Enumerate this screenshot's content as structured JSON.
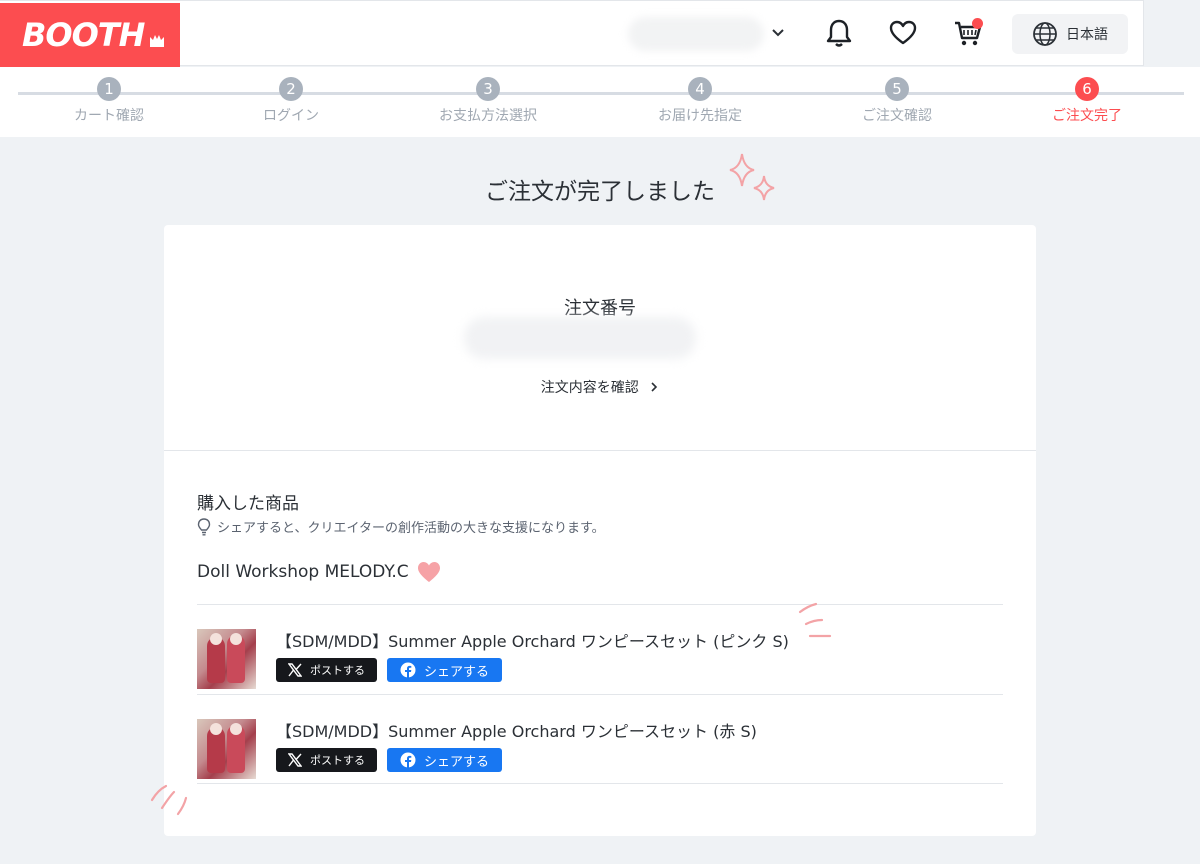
{
  "header": {
    "logo_text": "BOOTH",
    "language_label": "日本語"
  },
  "steps": [
    {
      "num": "1",
      "label": "カート確認"
    },
    {
      "num": "2",
      "label": "ログイン"
    },
    {
      "num": "3",
      "label": "お支払方法選択"
    },
    {
      "num": "4",
      "label": "お届け先指定"
    },
    {
      "num": "5",
      "label": "ご注文確認"
    },
    {
      "num": "6",
      "label": "ご注文完了"
    }
  ],
  "page_title": "ご注文が完了しました",
  "order": {
    "number_label": "注文番号",
    "details_link": "注文内容を確認"
  },
  "purchased": {
    "title": "購入した商品",
    "share_hint": "シェアすると、クリエイターの創作活動の大きな支援になります。",
    "shop_name": "Doll Workshop MELODY.C",
    "items": [
      {
        "name": "【SDM/MDD】Summer Apple Orchard ワンピースセット (ピンク S)",
        "x_label": "ポストする",
        "fb_label": "シェアする"
      },
      {
        "name": "【SDM/MDD】Summer Apple Orchard ワンピースセット (赤 S)",
        "x_label": "ポストする",
        "fb_label": "シェアする"
      }
    ]
  },
  "colors": {
    "brand": "#fc4d50",
    "facebook": "#1877f2",
    "x": "#16181c"
  }
}
